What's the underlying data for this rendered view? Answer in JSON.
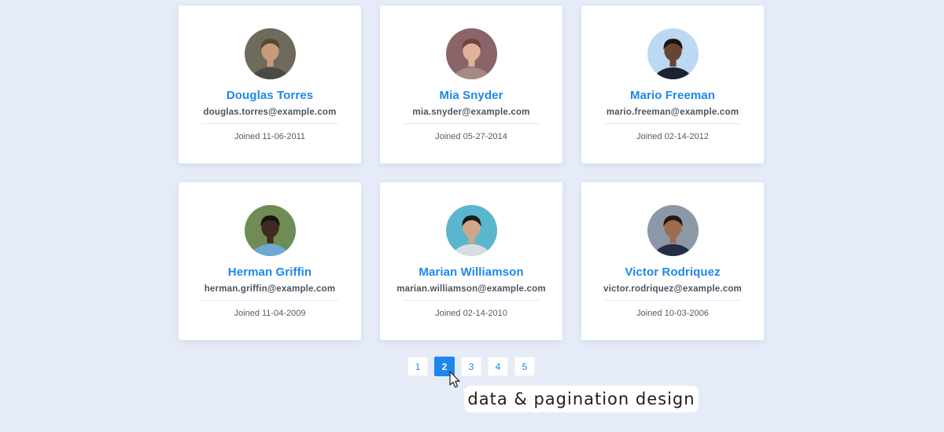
{
  "users": [
    {
      "name": "Douglas Torres",
      "email": "douglas.torres@example.com",
      "joined": "Joined 11-06-2011",
      "avatar": {
        "bg": "#6e6a5c",
        "skin": "#c99a7b",
        "hair": "#5a4634",
        "shirt": "#4a4a46"
      }
    },
    {
      "name": "Mia Snyder",
      "email": "mia.snyder@example.com",
      "joined": "Joined 05-27-2014",
      "avatar": {
        "bg": "#8a6468",
        "skin": "#e1b29b",
        "hair": "#6e4637",
        "shirt": "#a68a86"
      }
    },
    {
      "name": "Mario Freeman",
      "email": "mario.freeman@example.com",
      "joined": "Joined 02-14-2012",
      "avatar": {
        "bg": "#bcd9f3",
        "skin": "#6a4331",
        "hair": "#1c1411",
        "shirt": "#1c2234"
      }
    },
    {
      "name": "Herman Griffin",
      "email": "herman.griffin@example.com",
      "joined": "Joined 11-04-2009",
      "avatar": {
        "bg": "#6f8c55",
        "skin": "#3e2a21",
        "hair": "#1b1310",
        "shirt": "#6ea9d6"
      }
    },
    {
      "name": "Marian Williamson",
      "email": "marian.williamson@example.com",
      "joined": "Joined 02-14-2010",
      "avatar": {
        "bg": "#59b6cd",
        "skin": "#d0a68b",
        "hair": "#1d1a1a",
        "shirt": "#d9dde0"
      }
    },
    {
      "name": "Victor Rodriquez",
      "email": "victor.rodriquez@example.com",
      "joined": "Joined 10-03-2006",
      "avatar": {
        "bg": "#8c98a6",
        "skin": "#9d6c50",
        "hair": "#231a16",
        "shirt": "#242c48"
      }
    }
  ],
  "pagination": {
    "pages": [
      "1",
      "2",
      "3",
      "4",
      "5"
    ],
    "current": "2"
  },
  "caption": "data & pagination design",
  "colors": {
    "background": "#e5ecf8",
    "accent": "#1d87ec",
    "card": "#ffffff"
  }
}
